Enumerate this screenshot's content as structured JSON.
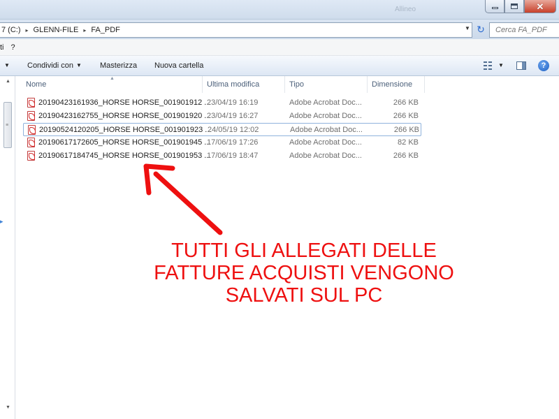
{
  "window": {
    "ghost_title": "Allineo",
    "buttons": {
      "minimize": "minimize-icon",
      "maximize": "maximize-icon",
      "close": "close-icon"
    }
  },
  "address": {
    "crumbs": [
      "7 (C:)",
      "GLENN-FILE",
      "FA_PDF"
    ],
    "separator": "▸",
    "search_placeholder": "Cerca FA_PDF"
  },
  "menubar": {
    "items": [
      "ti",
      "?"
    ]
  },
  "commandbar": {
    "condividi": "Condividi con",
    "masterizza": "Masterizza",
    "nuova_cartella": "Nuova cartella",
    "help": "?"
  },
  "columns": {
    "name": "Nome",
    "modified": "Ultima modifica",
    "type": "Tipo",
    "size": "Dimensione"
  },
  "files": [
    {
      "name": "20190423161936_HORSE HORSE_001901912 ...",
      "modified": "23/04/19 16:19",
      "type": "Adobe Acrobat Doc...",
      "size": "266 KB",
      "selected": false
    },
    {
      "name": "20190423162755_HORSE HORSE_001901920 ...",
      "modified": "23/04/19 16:27",
      "type": "Adobe Acrobat Doc...",
      "size": "266 KB",
      "selected": false
    },
    {
      "name": "20190524120205_HORSE HORSE_001901923 ...",
      "modified": "24/05/19 12:02",
      "type": "Adobe Acrobat Doc...",
      "size": "266 KB",
      "selected": true
    },
    {
      "name": "20190617172605_HORSE HORSE_001901945 ...",
      "modified": "17/06/19 17:26",
      "type": "Adobe Acrobat Doc...",
      "size": "82 KB",
      "selected": false
    },
    {
      "name": "20190617184745_HORSE HORSE_001901953 ...",
      "modified": "17/06/19 18:47",
      "type": "Adobe Acrobat Doc...",
      "size": "266 KB",
      "selected": false
    }
  ],
  "annotation": {
    "lines": [
      "TUTTI GLI ALLEGATI DELLE",
      "FATTURE ACQUISTI VENGONO",
      "SALVATI SUL PC"
    ],
    "color": "#ee1010"
  },
  "colors": {
    "accent": "#2c6bd0",
    "selection_border": "#8fb2dc",
    "annotation_red": "#ee1010"
  }
}
